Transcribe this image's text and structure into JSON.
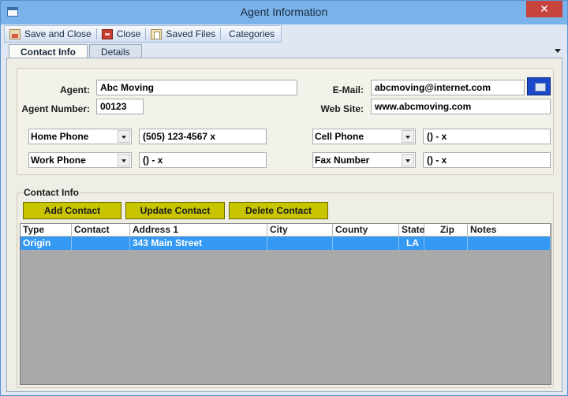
{
  "window": {
    "title": "Agent Information",
    "close_symbol": "✕"
  },
  "toolbar": {
    "save_close_label": "Save and Close",
    "close_label": "Close",
    "saved_files_label": "Saved Files",
    "categories_label": "Categories"
  },
  "tabs": [
    {
      "label": "Contact Info",
      "active": true
    },
    {
      "label": "Details",
      "active": false
    }
  ],
  "form": {
    "agent_label": "Agent:",
    "agent_value": "Abc Moving",
    "agent_number_label": "Agent Number:",
    "agent_number_value": "00123",
    "email_label": "E-Mail:",
    "email_value": "abcmoving@internet.com",
    "website_label": "Web Site:",
    "website_value": "www.abcmoving.com",
    "phone1_type": "Home Phone",
    "phone1_value": "(505) 123-4567 x",
    "phone2_type": "Work Phone",
    "phone2_value": "() - x",
    "phone3_type": "Cell Phone",
    "phone3_value": "() - x",
    "phone4_type": "Fax Number",
    "phone4_value": "() - x"
  },
  "contact_info": {
    "title": "Contact Info",
    "add_label": "Add Contact",
    "update_label": "Update Contact",
    "delete_label": "Delete Contact",
    "columns": [
      "Type",
      "Contact",
      "Address 1",
      "City",
      "County",
      "State",
      "Zip",
      "Notes"
    ],
    "rows": [
      [
        "Origin",
        "",
        "343 Main Street",
        "",
        "",
        "LA",
        "",
        ""
      ]
    ]
  },
  "colors": {
    "title_bar": "#79b3ea",
    "close_button": "#c7443d",
    "action_button": "#c9c400",
    "selected_row": "#3399f3",
    "email_button": "#1a48c8"
  }
}
